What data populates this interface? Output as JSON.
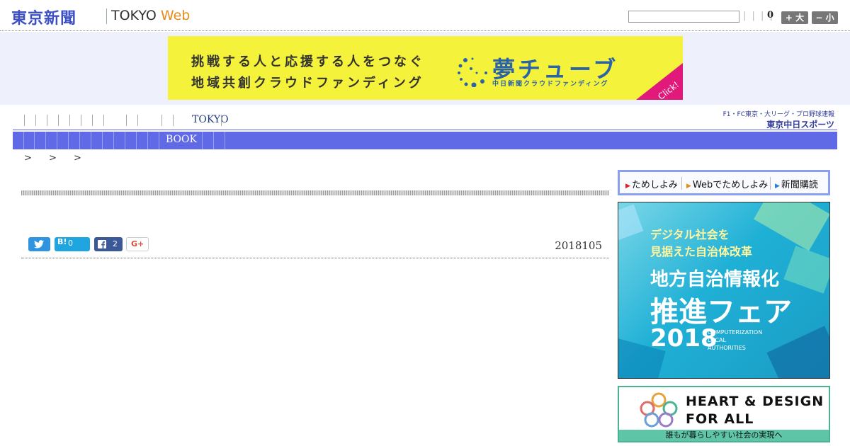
{
  "header": {
    "logo": "東京新聞",
    "logo_sub_tokyo": "TOKYO",
    "logo_sub_web": "Web",
    "search_placeholder": "",
    "pipes": "| | | |",
    "count": "0",
    "font_big": "+ 大",
    "font_small": "− 小"
  },
  "top_ad": {
    "line1": "挑戦する人と応援する人をつなぐ",
    "line2": "地域共創クラウドファンディング",
    "brand": "夢チューブ",
    "brand_sub": "中日新聞クラウドファンディング",
    "click": "Click!"
  },
  "nav1": {
    "label": "TOKYO"
  },
  "sports_link": {
    "line1": "F1・FC東京・大リーグ・プロ野球速報",
    "line2": "東京中日スポーツ"
  },
  "nav2": {
    "label": "BOOK"
  },
  "breadcrumb": "> > >",
  "share": {
    "hatena_count": "0",
    "facebook_count": "2",
    "gplus": "G+",
    "hatena_label": "B!"
  },
  "article": {
    "date": "2018105"
  },
  "subscribe": {
    "items": [
      "ためしよみ",
      "Webでためしよみ",
      "新聞購読"
    ]
  },
  "side_ad": {
    "line1": "デジタル社会を",
    "line2": "見据えた自治体改革",
    "title1": "地方自治情報化",
    "title2": "推進フェア",
    "year": "2018",
    "en1": "COMPUTERIZATION",
    "en2": "LOCAL",
    "en3": "AUTHORITIES"
  },
  "hd_ad": {
    "line1": "HEART & DESIGN",
    "line2": "FOR ALL",
    "caption": "誰もが暮らしやすい社会の実現へ"
  },
  "colors": {
    "brand_blue": "#3c4fc4",
    "nav_blue": "#616ae6",
    "web_orange": "#e88a1a"
  }
}
